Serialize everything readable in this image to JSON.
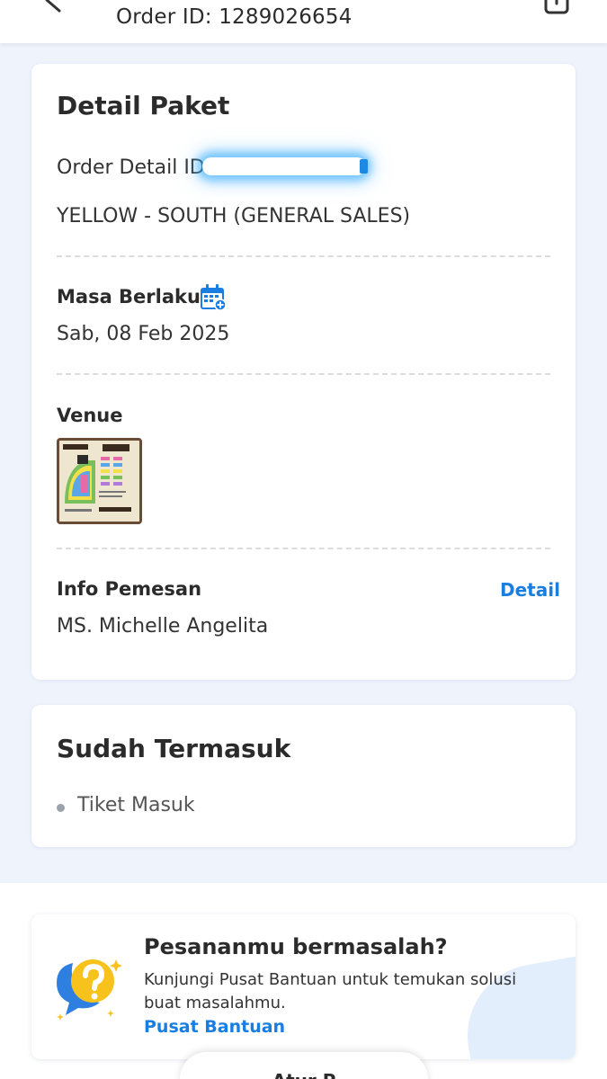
{
  "header": {
    "order_id": "Order ID: 1289026654"
  },
  "detail_card": {
    "title": "Detail Paket",
    "order_detail_label": "Order Detail ID",
    "package_name": "YELLOW - SOUTH (GENERAL SALES)",
    "validity_label": "Masa Berlaku",
    "validity_date": "Sab, 08 Feb 2025",
    "venue_label": "Venue",
    "venue_thumb_icon": "seating-plan-image",
    "booker_label": "Info Pemesan",
    "booker_link": "Detail",
    "booker_name": "MS. Michelle Angelita"
  },
  "included_card": {
    "title": "Sudah Termasuk",
    "items": [
      "Tiket Masuk"
    ]
  },
  "help": {
    "title": "Pesananmu bermasalah?",
    "description": "Kunjungi Pusat Bantuan untuk temukan solusi buat masalahmu.",
    "link": "Pusat Bantuan"
  },
  "bottom_button": {
    "label": "Atur P"
  },
  "colors": {
    "accent": "#1a7de0",
    "background": "#eef3fc"
  }
}
